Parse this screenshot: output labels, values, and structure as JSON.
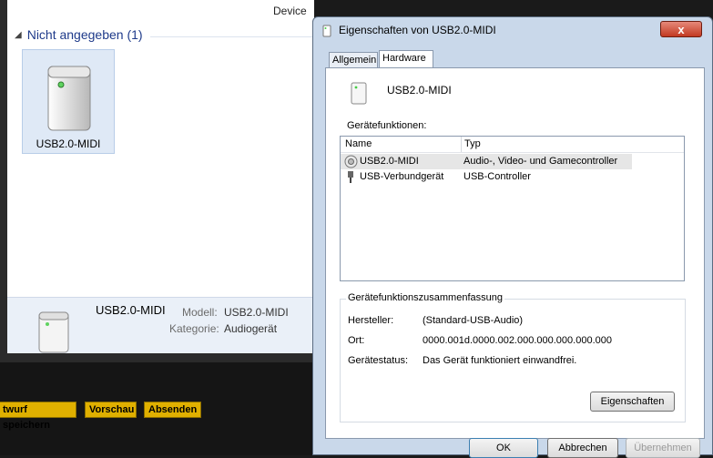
{
  "explorer": {
    "column_header": "Device",
    "group": {
      "label": "Nicht angegeben (1)"
    },
    "device_tile": {
      "label": "USB2.0-MIDI"
    },
    "details": {
      "name": "USB2.0-MIDI",
      "model_label": "Modell:",
      "model_value": "USB2.0-MIDI",
      "category_label": "Kategorie:",
      "category_value": "Audiogerät"
    }
  },
  "toolbar": {
    "draft_label": "twurf speichern",
    "preview_label": "Vorschau",
    "send_label": "Absenden"
  },
  "dialog": {
    "title": "Eigenschaften von USB2.0-MIDI",
    "close_glyph": "x",
    "tabs": [
      "Allgemein",
      "Hardware"
    ],
    "active_tab": "Hardware",
    "device_name": "USB2.0-MIDI",
    "functions_label": "Gerätefunktionen:",
    "columns": [
      "Name",
      "Typ"
    ],
    "rows": [
      {
        "name": "USB2.0-MIDI",
        "type": "Audio-, Video- und Gamecontroller",
        "icon": "speaker-icon",
        "selected": true
      },
      {
        "name": "USB-Verbundgerät",
        "type": "USB-Controller",
        "icon": "usb-plug-icon",
        "selected": false
      }
    ],
    "summary": {
      "legend": "Gerätefunktionszusammenfassung",
      "manufacturer_label": "Hersteller:",
      "manufacturer_value": "(Standard-USB-Audio)",
      "location_label": "Ort:",
      "location_value": "0000.001d.0000.002.000.000.000.000.000",
      "status_label": "Gerätestatus:",
      "status_value": "Das Gerät funktioniert einwandfrei.",
      "properties_button": "Eigenschaften"
    },
    "buttons": {
      "ok": "OK",
      "cancel": "Abbrechen",
      "apply": "Übernehmen"
    }
  },
  "colors": {
    "accent_yellow": "#e0b000",
    "close_red": "#c23a22",
    "group_blue": "#1e3a8a"
  }
}
